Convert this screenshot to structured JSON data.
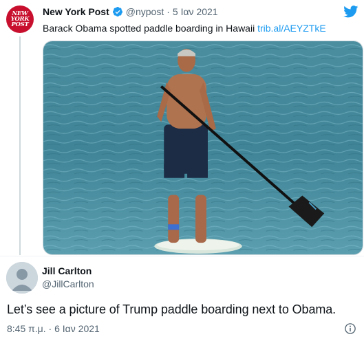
{
  "parent_tweet": {
    "avatar_text": [
      "NEW",
      "YORK",
      "POST"
    ],
    "name": "New York Post",
    "handle": "@nypost",
    "separator": "·",
    "date": "5 Ιαν 2021",
    "text": "Barack Obama spotted paddle boarding in Hawaii",
    "link": "trib.al/AEYZTkE",
    "verified_icon": "verified-badge-icon",
    "brand_icon": "twitter-bird-icon"
  },
  "reply": {
    "name": "Jill Carlton",
    "handle": "@JillCarlton",
    "text": "Let’s see a picture of Trump paddle boarding next to Obama.",
    "time": "8:45 π.μ.",
    "separator": "·",
    "date": "6 Ιαν 2021",
    "meta_icon": "info-icon"
  },
  "colors": {
    "accent": "#1d9bf0",
    "nypost_red": "#c8102e",
    "text_primary": "#0f1419",
    "text_secondary": "#536471"
  }
}
